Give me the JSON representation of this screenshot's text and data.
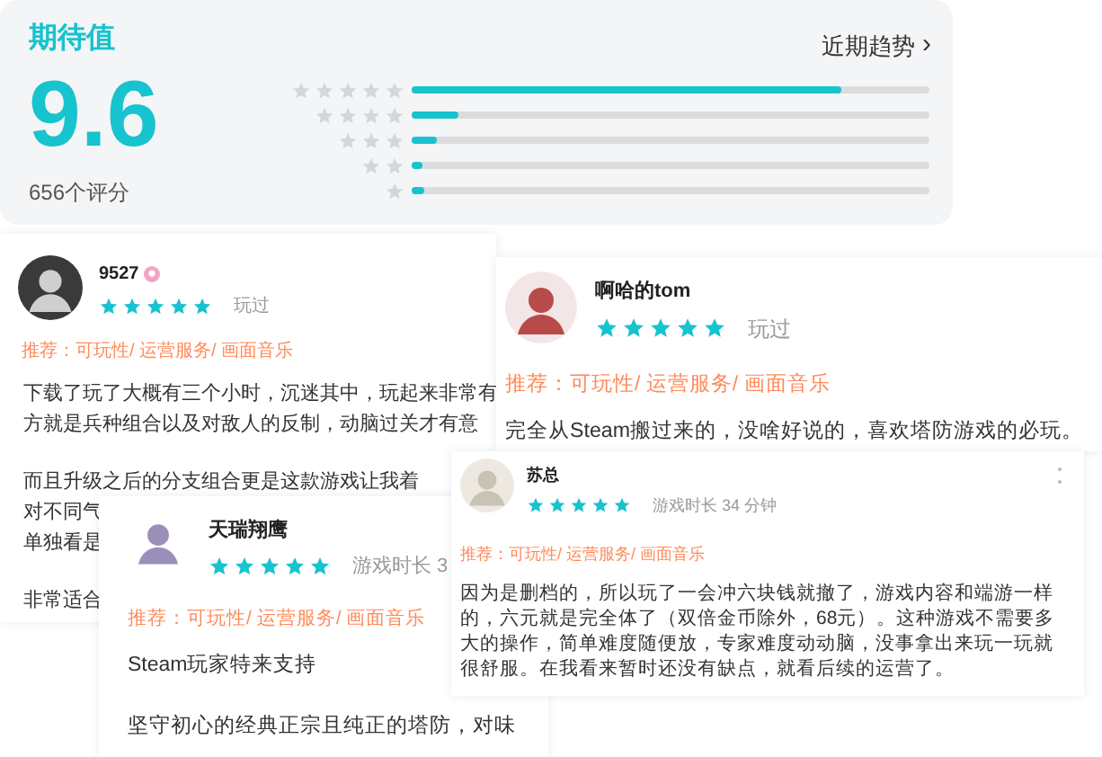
{
  "summary": {
    "title": "期待值",
    "score": "9.6",
    "count": "656个评分",
    "trend_link": "近期趋势",
    "trend_arrow": "›",
    "distribution": [
      {
        "level": 0.83
      },
      {
        "level": 0.09
      },
      {
        "level": 0.05
      },
      {
        "level": 0.02
      },
      {
        "level": 0.025
      }
    ]
  },
  "reviews": [
    {
      "user": "9527",
      "badge": true,
      "stars": 5,
      "meta": "玩过",
      "tags": "推荐：可玩性/ 运营服务/ 画面音乐",
      "paragraphs": [
        [
          "下载了玩了大概有三个小时，沉迷其中，玩起来非常有",
          "方就是兵种组合以及对敌人的反制，动脑过关才有意"
        ],
        [
          "而且升级之后的分支组合更是这款游戏让我着",
          "对不同气",
          "单独看是"
        ],
        [
          "非常适合"
        ]
      ],
      "menu": false
    },
    {
      "user": "啊哈的tom",
      "badge": false,
      "stars": 5,
      "meta": "玩过",
      "tags": "推荐：可玩性/ 运营服务/ 画面音乐",
      "paragraphs": [
        [
          "完全从Steam搬过来的，没啥好说的，喜欢塔防游戏的必玩。"
        ]
      ],
      "menu": false
    },
    {
      "user": "天瑞翔鹰",
      "badge": false,
      "stars": 5,
      "meta": "游戏时长 3",
      "tags": "推荐：可玩性/ 运营服务/ 画面音乐",
      "paragraphs": [
        [
          "Steam玩家特来支持"
        ],
        [
          "坚守初心的经典正宗且纯正的塔防，对味"
        ]
      ],
      "menu": false
    },
    {
      "user": "苏总",
      "badge": false,
      "stars": 5,
      "meta": "游戏时长 34 分钟",
      "tags": "推荐：可玩性/ 运营服务/ 画面音乐",
      "paragraphs": [
        [
          "因为是删档的，所以玩了一会冲六块钱就撤了，游戏内容和端游一样的，六元就是完全体了（双倍金币除外，68元）。这种游戏不需要多大的操作，简单难度随便放，专家难度动动脑，没事拿出来玩一玩就很舒服。在我看来暂时还没有缺点，就看后续的运营了。"
        ]
      ],
      "menu": true
    }
  ]
}
